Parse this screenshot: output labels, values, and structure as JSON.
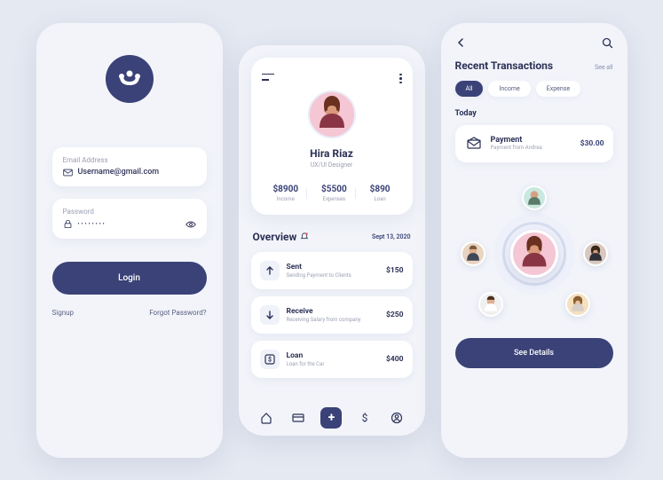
{
  "login": {
    "email_label": "Email Address",
    "email_value": "Username@gmail.com",
    "password_label": "Password",
    "password_masked": "••••••••",
    "login_btn": "Login",
    "signup": "Signup",
    "forgot": "Forgot Password?"
  },
  "profile": {
    "name": "Hira Riaz",
    "role": "UX/UI Designer",
    "stats": [
      {
        "value": "$8900",
        "label": "Income"
      },
      {
        "value": "$5500",
        "label": "Expenses"
      },
      {
        "value": "$890",
        "label": "Loan"
      }
    ],
    "overview_title": "Overview",
    "overview_date": "Sept 13, 2020",
    "transactions": [
      {
        "icon": "arrow-up",
        "title": "Sent",
        "sub": "Sending Payment to Clients",
        "amount": "$150"
      },
      {
        "icon": "arrow-down",
        "title": "Receive",
        "sub": "Receiving Salary from company",
        "amount": "$250"
      },
      {
        "icon": "dollar-box",
        "title": "Loan",
        "sub": "Loan for the Car",
        "amount": "$400"
      }
    ]
  },
  "recent": {
    "title": "Recent Transactions",
    "see_all": "See all",
    "tabs": [
      "All",
      "Income",
      "Expense"
    ],
    "today_label": "Today",
    "payment": {
      "title": "Payment",
      "sub": "Payment from Andrea",
      "amount": "$30.00"
    },
    "details_btn": "See Details"
  }
}
